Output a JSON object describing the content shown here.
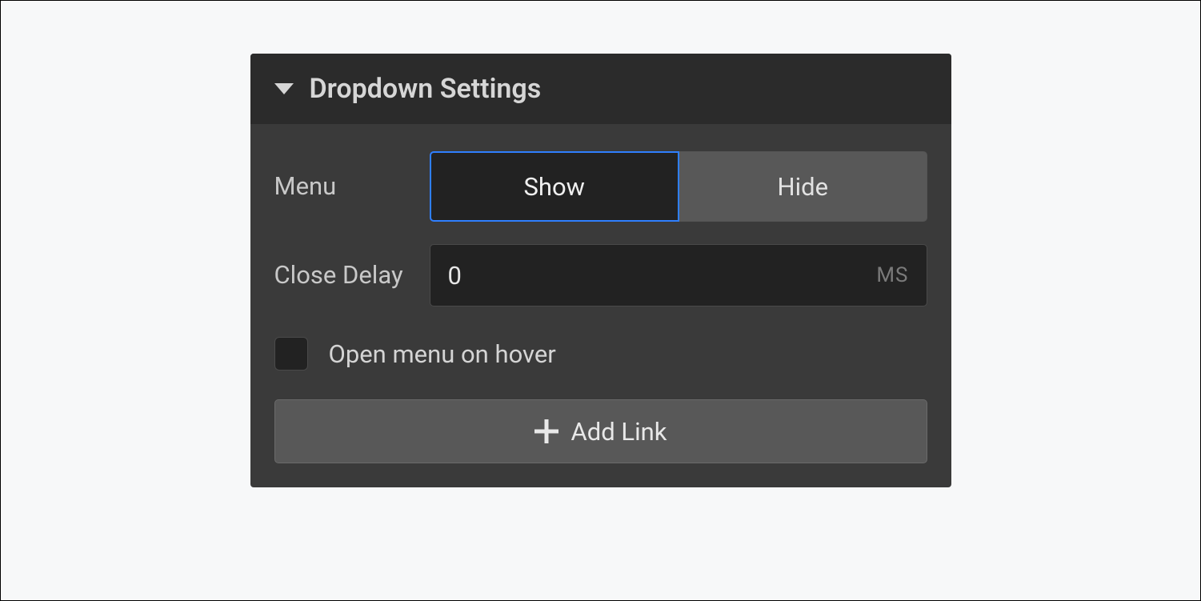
{
  "panel": {
    "title": "Dropdown Settings"
  },
  "menu": {
    "label": "Menu",
    "show": "Show",
    "hide": "Hide"
  },
  "closeDelay": {
    "label": "Close Delay",
    "value": "0",
    "unit": "MS"
  },
  "hover": {
    "label": "Open menu on hover"
  },
  "addLink": {
    "label": "Add Link"
  }
}
